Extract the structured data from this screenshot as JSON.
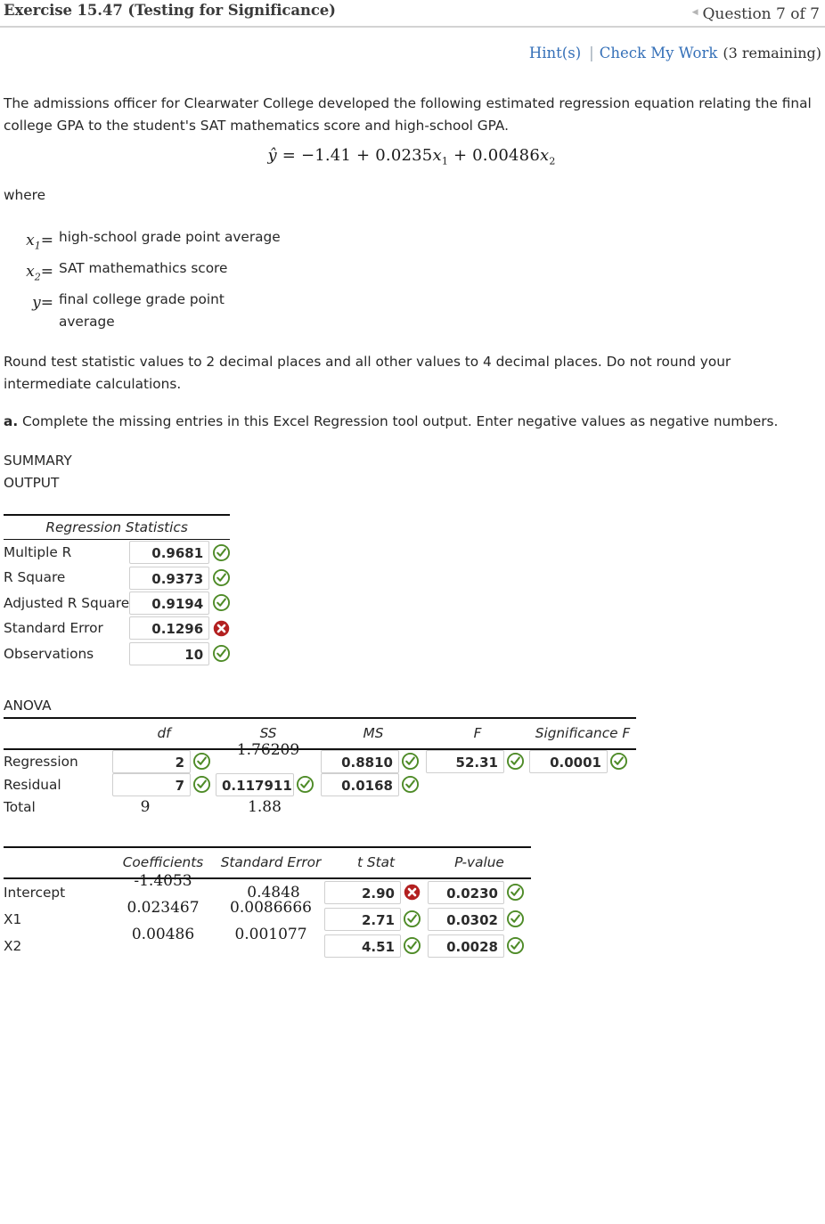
{
  "header": {
    "exercise_title": "Exercise 15.47 (Testing for Significance)",
    "prev_arrow_icon": "caret-left-icon",
    "question_counter": "Question 7 of 7"
  },
  "hints": {
    "hint_label": "Hint(s)",
    "divider": "|",
    "check_label": "Check My Work",
    "remaining": "(3 remaining)",
    "link_color": "#3570b8"
  },
  "problem": {
    "intro": "The admissions officer for Clearwater College developed the following estimated regression equation relating the final college GPA to the student's SAT mathematics score and high-school GPA.",
    "equation_plain": "ŷ = −1.41 + 0.0235x₁ + 0.00486x₂",
    "equation_parts": {
      "yhat": "ŷ",
      "eq": "=",
      "intercept": "−1.41",
      "plus1": "+",
      "b1": "0.0235",
      "x1": "x",
      "x1sub": "1",
      "plus2": "+",
      "b2": "0.00486",
      "x2": "x",
      "x2sub": "2"
    },
    "where_label": "where",
    "variables": [
      {
        "symbol": "x",
        "subscript": "1",
        "equals": "=",
        "definition": "high-school grade point average"
      },
      {
        "symbol": "x",
        "subscript": "2",
        "equals": "=",
        "definition": "SAT mathemathics score"
      },
      {
        "symbol": "y",
        "subscript": "",
        "equals": "=",
        "definition": "final college grade point average"
      }
    ],
    "rounding_note": "Round test statistic values to 2 decimal places and all other values to 4 decimal places. Do not round your intermediate calculations.",
    "part_a_label": "a.",
    "part_a_text": " Complete the missing entries in this Excel Regression tool output. Enter negative values as negative numbers."
  },
  "summary": {
    "caption_line1": "SUMMARY",
    "caption_line2": "OUTPUT",
    "section_header": "Regression Statistics",
    "rows": [
      {
        "label": "Multiple R",
        "value": "0.9681",
        "status": "correct"
      },
      {
        "label": "R Square",
        "value": "0.9373",
        "status": "correct"
      },
      {
        "label": "Adjusted R Square",
        "value": "0.9194",
        "status": "correct"
      },
      {
        "label": "Standard Error",
        "value": "0.1296",
        "status": "incorrect"
      },
      {
        "label": "Observations",
        "value": "10",
        "status": "correct"
      }
    ]
  },
  "anova": {
    "caption": "ANOVA",
    "columns": [
      "",
      "df",
      "SS",
      "MS",
      "F",
      "Significance F"
    ],
    "rows": [
      {
        "label": "Regression",
        "df": {
          "value": "2",
          "kind": "input",
          "status": "correct"
        },
        "ss": {
          "value": "1.76209",
          "kind": "static",
          "status": "none"
        },
        "ms": {
          "value": "0.8810",
          "kind": "input",
          "status": "correct"
        },
        "f": {
          "value": "52.31",
          "kind": "input",
          "status": "correct"
        },
        "sig": {
          "value": "0.0001",
          "kind": "input",
          "status": "correct"
        }
      },
      {
        "label": "Residual",
        "df": {
          "value": "7",
          "kind": "input",
          "status": "correct"
        },
        "ss": {
          "value": "0.117911",
          "kind": "input",
          "status": "correct"
        },
        "ms": {
          "value": "0.0168",
          "kind": "input",
          "status": "correct"
        },
        "f": {
          "value": "",
          "kind": "empty",
          "status": "none"
        },
        "sig": {
          "value": "",
          "kind": "empty",
          "status": "none"
        }
      },
      {
        "label": "Total",
        "df": {
          "value": "9",
          "kind": "static",
          "status": "none"
        },
        "ss": {
          "value": "1.88",
          "kind": "static",
          "status": "none"
        },
        "ms": {
          "value": "",
          "kind": "empty",
          "status": "none"
        },
        "f": {
          "value": "",
          "kind": "empty",
          "status": "none"
        },
        "sig": {
          "value": "",
          "kind": "empty",
          "status": "none"
        }
      }
    ]
  },
  "coefficients": {
    "columns": [
      "",
      "Coefficients",
      "Standard Error",
      "t Stat",
      "P-value"
    ],
    "rows": [
      {
        "label": "Intercept",
        "coef": {
          "value": "-1.4053",
          "kind": "static",
          "status": "none"
        },
        "se": {
          "value": "0.4848",
          "kind": "static",
          "status": "none"
        },
        "tstat": {
          "value": "2.90",
          "kind": "input",
          "status": "incorrect"
        },
        "pval": {
          "value": "0.0230",
          "kind": "input",
          "status": "correct"
        }
      },
      {
        "label": "X1",
        "coef": {
          "value": "0.023467",
          "kind": "static",
          "status": "none"
        },
        "se": {
          "value": "0.0086666",
          "kind": "static",
          "status": "none"
        },
        "tstat": {
          "value": "2.71",
          "kind": "input",
          "status": "correct"
        },
        "pval": {
          "value": "0.0302",
          "kind": "input",
          "status": "correct"
        }
      },
      {
        "label": "X2",
        "coef": {
          "value": "0.00486",
          "kind": "static",
          "status": "none"
        },
        "se": {
          "value": "0.001077",
          "kind": "static",
          "status": "none"
        },
        "tstat": {
          "value": "4.51",
          "kind": "input",
          "status": "correct"
        },
        "pval": {
          "value": "0.0028",
          "kind": "input",
          "status": "correct"
        }
      }
    ]
  },
  "icons": {
    "correct": {
      "name": "check-circle-icon",
      "color": "#4e8b27"
    },
    "incorrect": {
      "name": "x-circle-icon",
      "color": "#b32020"
    }
  }
}
